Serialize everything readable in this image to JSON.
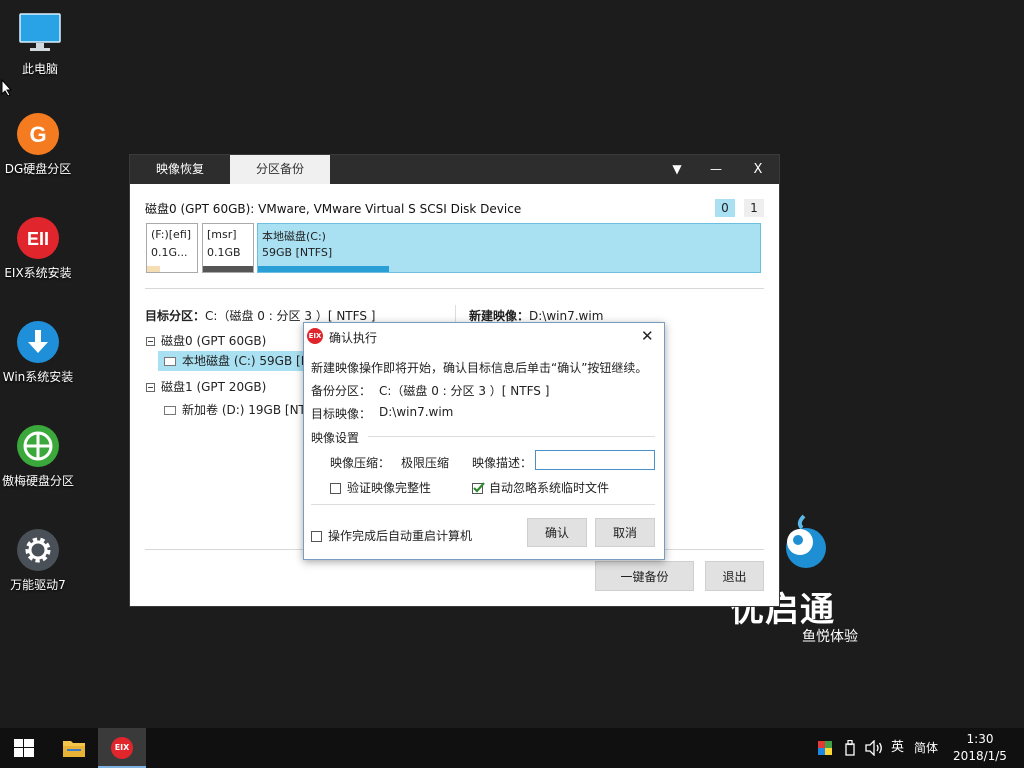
{
  "desktop": {
    "icons": [
      {
        "label": "此电脑",
        "icon": "computer-icon"
      },
      {
        "label": "DG硬盘分区",
        "icon": "dg-partition-icon"
      },
      {
        "label": "EIX系统安装",
        "icon": "eix-install-icon"
      },
      {
        "label": "Win系统安装",
        "icon": "win-install-icon"
      },
      {
        "label": "傲梅硬盘分区",
        "icon": "aomei-partition-icon"
      },
      {
        "label": "万能驱动7",
        "icon": "driver-gear-icon"
      }
    ],
    "brand": {
      "name": "优启通",
      "subtitle": "鱼悦体验"
    }
  },
  "window": {
    "tabs": [
      {
        "label": "映像恢复",
        "active": false
      },
      {
        "label": "分区备份",
        "active": true
      }
    ],
    "controls": {
      "menu": "▼",
      "minimize": "—",
      "close": "X"
    },
    "disk_title": "磁盘0 (GPT 60GB): VMware, VMware Virtual S SCSI Disk Device",
    "disk_selector": [
      "0",
      "1"
    ],
    "partitions": [
      {
        "line1": "(F:)[efi]",
        "line2": "0.1G...",
        "used": 0.25
      },
      {
        "line1": "[msr]",
        "line2": "0.1GB",
        "used": 1.0
      },
      {
        "line1": "本地磁盘(C:)",
        "line2": "59GB [NTFS]",
        "used": 0.26
      }
    ],
    "target_label": "目标分区：",
    "target_value": "C:（磁盘 0 : 分区 3 ）[ NTFS ]",
    "new_image_label": "新建映像：",
    "new_image_value": "D:\\win7.wim",
    "tree": [
      {
        "label": "磁盘0 (GPT 60GB)"
      },
      {
        "label": "本地磁盘 (C:) 59GB [NTFS]",
        "selected": true
      },
      {
        "label": "磁盘1 (GPT 20GB)"
      },
      {
        "label": "新加卷 (D:) 19GB [NTFS]"
      }
    ],
    "buttons": {
      "backup": "一键备份",
      "exit": "退出"
    }
  },
  "dialog": {
    "app_icon_text": "EIX",
    "title": "确认执行",
    "close": "✕",
    "message": "新建映像操作即将开始，确认目标信息后单击“确认”按钮继续。",
    "backup_partition_label": "备份分区：",
    "backup_partition_value": "C:（磁盘 0 : 分区 3 ）[ NTFS ]",
    "target_image_label": "目标映像：",
    "target_image_value": "D:\\win7.wim",
    "settings_label": "映像设置",
    "compress_label": "映像压缩：",
    "compress_value": "极限压缩",
    "desc_label": "映像描述：",
    "desc_value": "",
    "verify_label": "验证映像完整性",
    "verify_checked": false,
    "ignore_temp_label": "自动忽略系统临时文件",
    "ignore_temp_checked": true,
    "reboot_label": "操作完成后自动重启计算机",
    "reboot_checked": false,
    "ok": "确认",
    "cancel": "取消"
  },
  "taskbar": {
    "ime_lang": "英",
    "ime_mode": "简体",
    "time": "1:30",
    "date": "2018/1/5",
    "app_icon_text": "EIX"
  },
  "colors": {
    "dg": "#f47b20",
    "eix": "#e0262c",
    "win": "#1e8fd8",
    "aomei": "#3aa83a",
    "selected_partition": "#a9e0f2",
    "bar": "#2a9fd6",
    "check": "#2e8b2e"
  }
}
